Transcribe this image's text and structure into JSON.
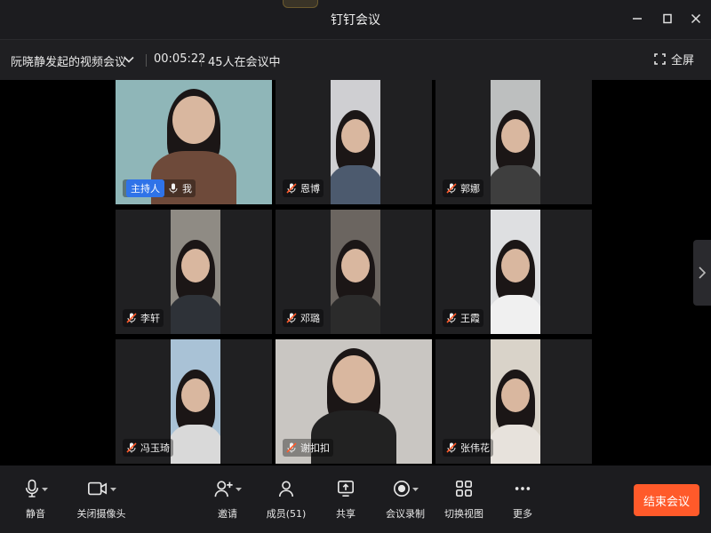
{
  "app": {
    "title": "钉钉会议"
  },
  "infobar": {
    "meeting_name": "阮晓静发起的视频会议",
    "elapsed": "00:05:22",
    "in_meeting": "45人在会议中",
    "fullscreen_label": "全屏"
  },
  "host_tag": "主持人",
  "participants": [
    {
      "name": "我",
      "mic": "on",
      "bg": "#8fb6b8",
      "shirt": "#6e4a3a"
    },
    {
      "name": "恩博",
      "mic": "muted",
      "bg": "#cfcfd2",
      "shirt": "#4c5a6e"
    },
    {
      "name": "郭娜",
      "mic": "muted",
      "bg": "#bdbfbf",
      "shirt": "#3e3e3e"
    },
    {
      "name": "李轩",
      "mic": "muted",
      "bg": "#8f8b84",
      "shirt": "#2e3238"
    },
    {
      "name": "邓璐",
      "mic": "muted",
      "bg": "#6b6560",
      "shirt": "#2b2b2b"
    },
    {
      "name": "王霞",
      "mic": "muted",
      "bg": "#dedfe1",
      "shirt": "#f0f0f0"
    },
    {
      "name": "冯玉琦",
      "mic": "muted",
      "bg": "#a9c2d6",
      "shirt": "#d9d9d9"
    },
    {
      "name": "谢扣扣",
      "mic": "muted",
      "bg": "#c9c6c2",
      "shirt": "#222222"
    },
    {
      "name": "张伟花",
      "mic": "muted",
      "bg": "#d9d3c9",
      "shirt": "#e7e2dc"
    }
  ],
  "toolbar": {
    "mute": "静音",
    "camera_off": "关闭摄像头",
    "invite": "邀请",
    "members": "成员(51)",
    "share": "共享",
    "record": "会议录制",
    "switch_view": "切换视图",
    "more": "更多",
    "end": "结束会议"
  },
  "colors": {
    "accent_end": "#ff5a2a",
    "host_tag": "#2f73e8",
    "muted_icon": "#ff5a2a"
  }
}
